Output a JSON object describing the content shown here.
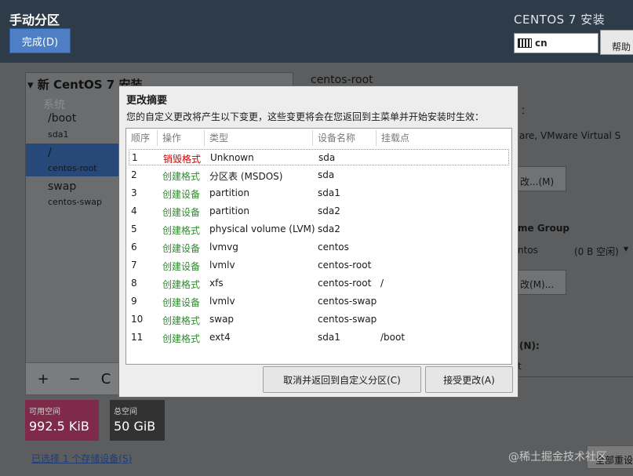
{
  "header": {
    "title": "手动分区",
    "done_label": "完成(D)",
    "installer_title": "CENTOS 7 安装",
    "keyboard_layout": "cn",
    "help_label": "帮助"
  },
  "left_panel": {
    "tree_title": "新 CentOS 7 安装",
    "section_label": "系统",
    "items": [
      {
        "name": "/boot",
        "device": "sda1"
      },
      {
        "name": "/",
        "device": "centos-root"
      },
      {
        "name": "swap",
        "device": "centos-swap"
      }
    ],
    "toolbar": {
      "add": "+",
      "remove": "−",
      "refresh": "C"
    },
    "available_space": {
      "label": "可用空间",
      "value": "992.5 KiB"
    },
    "total_space": {
      "label": "总空间",
      "value": "50 GiB"
    },
    "storage_link": "已选择 1 个存储设备(S)",
    "reset_label": "全部重设"
  },
  "right_panel": {
    "title": "centos-root",
    "colon": "：",
    "device_text": "are, VMware Virtual S",
    "modify_label": "改...(M)",
    "group_label": "me Group",
    "vg_name": "ntos",
    "vg_free": "(0 B 空闲)",
    "modify2_label": "改(M)...",
    "n_label": "(N):",
    "n_value": "t"
  },
  "dialog": {
    "title": "更改摘要",
    "description": "您的自定义更改将产生以下变更，这些变更将会在您返回到主菜单并开始安装时生效：",
    "columns": [
      "顺序",
      "操作",
      "类型",
      "设备名称",
      "挂载点"
    ],
    "rows": [
      {
        "order": "1",
        "action": "销毁格式",
        "type": "Unknown",
        "device": "sda",
        "mount": ""
      },
      {
        "order": "2",
        "action": "创建格式",
        "type": "分区表 (MSDOS)",
        "device": "sda",
        "mount": ""
      },
      {
        "order": "3",
        "action": "创建设备",
        "type": "partition",
        "device": "sda1",
        "mount": ""
      },
      {
        "order": "4",
        "action": "创建设备",
        "type": "partition",
        "device": "sda2",
        "mount": ""
      },
      {
        "order": "5",
        "action": "创建格式",
        "type": "physical volume (LVM)",
        "device": "sda2",
        "mount": ""
      },
      {
        "order": "6",
        "action": "创建设备",
        "type": "lvmvg",
        "device": "centos",
        "mount": ""
      },
      {
        "order": "7",
        "action": "创建设备",
        "type": "lvmlv",
        "device": "centos-root",
        "mount": ""
      },
      {
        "order": "8",
        "action": "创建格式",
        "type": "xfs",
        "device": "centos-root",
        "mount": "/"
      },
      {
        "order": "9",
        "action": "创建设备",
        "type": "lvmlv",
        "device": "centos-swap",
        "mount": ""
      },
      {
        "order": "10",
        "action": "创建格式",
        "type": "swap",
        "device": "centos-swap",
        "mount": ""
      },
      {
        "order": "11",
        "action": "创建格式",
        "type": "ext4",
        "device": "sda1",
        "mount": "/boot"
      }
    ],
    "cancel_label": "取消并返回到自定义分区(C)",
    "accept_label": "接受更改(A)"
  },
  "colors": {
    "destroy": "#cc0000",
    "create": "#2e8b2e",
    "header_bg": "#2e3b48",
    "selection": "#26497a"
  },
  "watermark": "@稀土掘金技术社区"
}
